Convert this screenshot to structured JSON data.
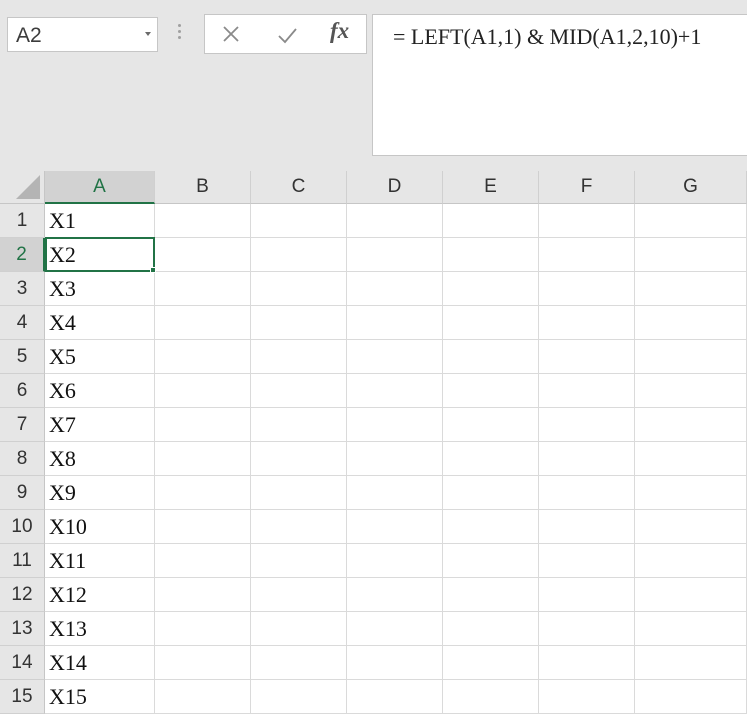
{
  "name_box": {
    "value": "A2"
  },
  "formula_bar": {
    "fx_label": "fx",
    "formula": "= LEFT(A1,1) & MID(A1,2,10)+1"
  },
  "columns": [
    "A",
    "B",
    "C",
    "D",
    "E",
    "F",
    "G"
  ],
  "selected_column": "A",
  "selected_row": "2",
  "rows": [
    {
      "num": "1",
      "a": "X1"
    },
    {
      "num": "2",
      "a": "X2"
    },
    {
      "num": "3",
      "a": "X3"
    },
    {
      "num": "4",
      "a": "X4"
    },
    {
      "num": "5",
      "a": "X5"
    },
    {
      "num": "6",
      "a": "X6"
    },
    {
      "num": "7",
      "a": "X7"
    },
    {
      "num": "8",
      "a": "X8"
    },
    {
      "num": "9",
      "a": "X9"
    },
    {
      "num": "10",
      "a": "X10"
    },
    {
      "num": "11",
      "a": "X11"
    },
    {
      "num": "12",
      "a": "X12"
    },
    {
      "num": "13",
      "a": "X13"
    },
    {
      "num": "14",
      "a": "X14"
    },
    {
      "num": "15",
      "a": "X15"
    }
  ],
  "colors": {
    "accent": "#217346",
    "header_bg": "#e6e6e6",
    "gridline": "#dadada"
  }
}
